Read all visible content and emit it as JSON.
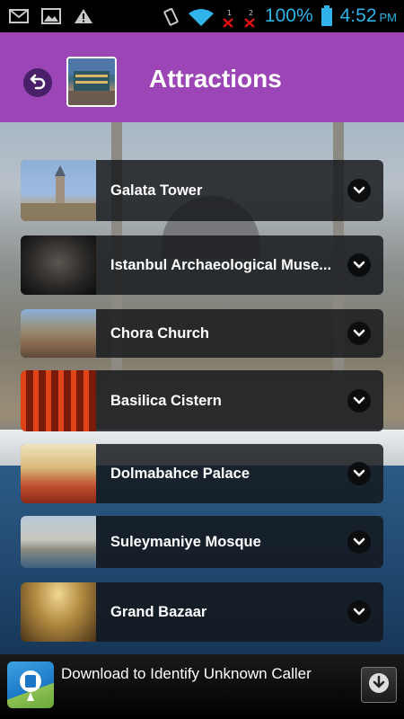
{
  "status_bar": {
    "battery": "100%",
    "time": "4:52",
    "ampm": "PM",
    "icons": [
      "gmail-icon",
      "image-icon",
      "warning-icon",
      "vibrate-icon",
      "wifi-icon",
      "sim1-no-signal-icon",
      "sim2-no-signal-icon",
      "battery-icon"
    ],
    "color": "#2fb3e8"
  },
  "header": {
    "title": "Attractions",
    "bg_color": "#9b45b6"
  },
  "attractions": [
    {
      "label": "Galata Tower"
    },
    {
      "label": "Istanbul Archaeological Muse..."
    },
    {
      "label": "Chora Church"
    },
    {
      "label": "Basilica Cistern"
    },
    {
      "label": "Dolmabahce Palace"
    },
    {
      "label": "Suleymaniye Mosque"
    },
    {
      "label": "Grand Bazaar"
    }
  ],
  "ad": {
    "text": "Download to Identify Unknown Caller"
  }
}
